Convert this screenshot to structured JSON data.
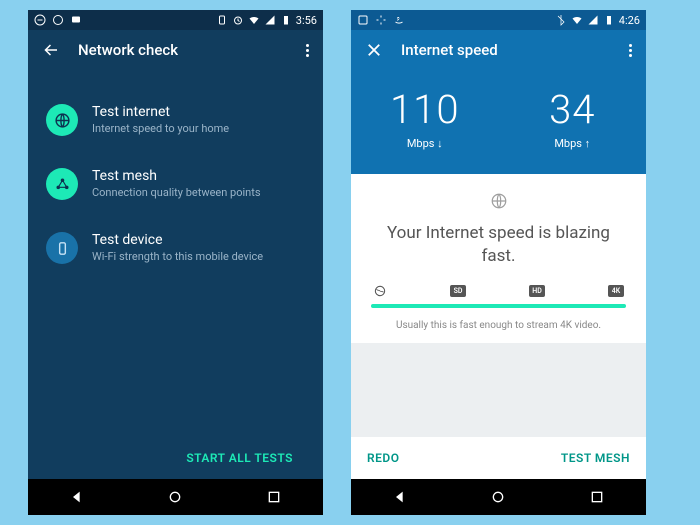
{
  "left": {
    "clock": "3:56",
    "title": "Network check",
    "items": [
      {
        "title": "Test internet",
        "subtitle": "Internet speed to your home",
        "circle": "green",
        "icon": "globe"
      },
      {
        "title": "Test mesh",
        "subtitle": "Connection quality between points",
        "circle": "green",
        "icon": "mesh"
      },
      {
        "title": "Test device",
        "subtitle": "Wi-Fi strength to this mobile device",
        "circle": "blue",
        "icon": "phone"
      }
    ],
    "footer_button": "START ALL TESTS"
  },
  "right": {
    "clock": "4:26",
    "title": "Internet speed",
    "download_value": "110",
    "download_unit": "Mbps ↓",
    "upload_value": "34",
    "upload_unit": "Mbps ↑",
    "message": "Your Internet speed is blazing fast.",
    "gauge_labels": {
      "g1": "",
      "g2": "SD",
      "g3": "HD",
      "g4": "4K"
    },
    "note": "Usually this is fast enough to stream 4K video.",
    "footer_left": "REDO",
    "footer_right": "TEST MESH"
  }
}
